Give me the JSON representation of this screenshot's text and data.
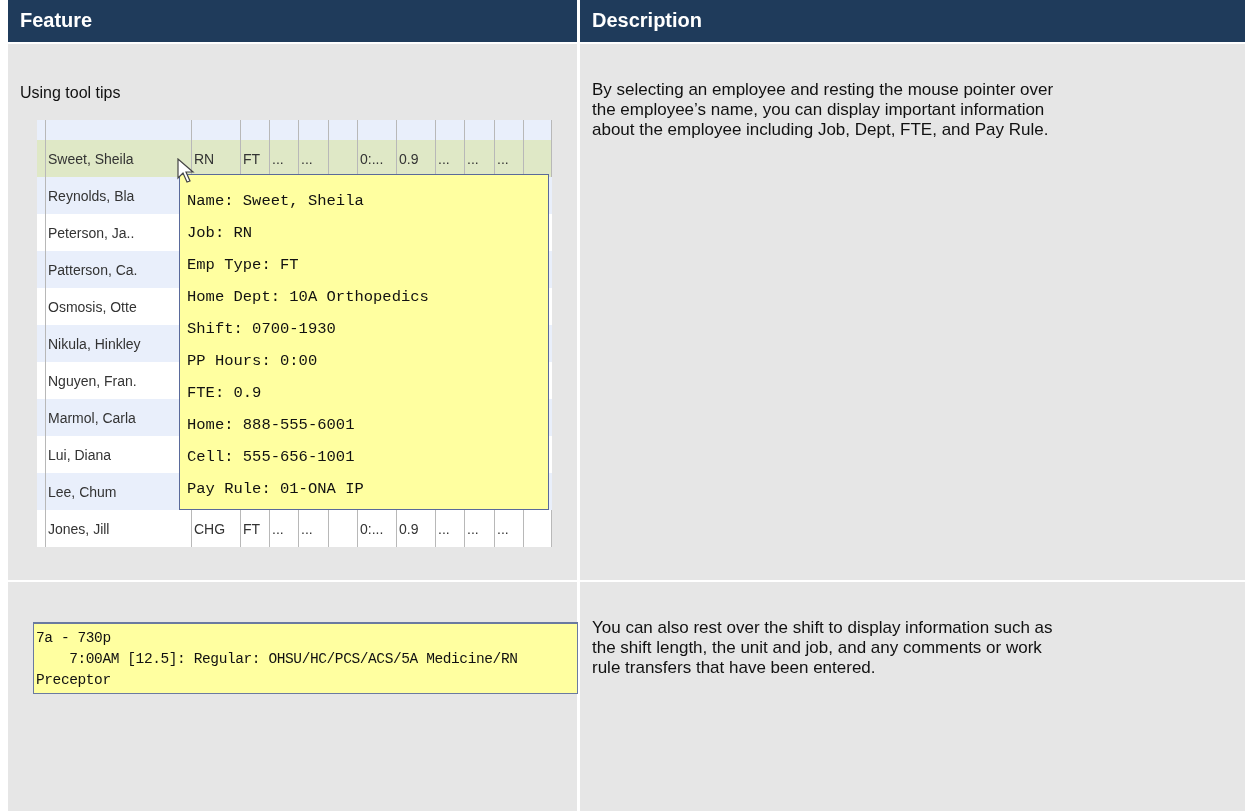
{
  "table": {
    "columns": [
      "Feature",
      "Description"
    ],
    "rows": [
      {
        "feature": "Using tool tips",
        "screenshot": {
          "kind": "roster",
          "rows": [
            {
              "cells": [
                "",
                "",
                "",
                "",
                "",
                "",
                "",
                "",
                "",
                "",
                "",
                ""
              ],
              "selected": false
            },
            {
              "cells": [
                "Sweet, Sheila",
                "RN",
                "FT",
                "...",
                "...",
                "",
                "0:...",
                "0.9",
                "...",
                "...",
                "...",
                ""
              ],
              "selected": true
            },
            {
              "cells": [
                "Reynolds, Bla"
              ],
              "selected": false
            },
            {
              "cells": [
                "Peterson, Ja.."
              ],
              "selected": false
            },
            {
              "cells": [
                "Patterson, Ca."
              ],
              "selected": false
            },
            {
              "cells": [
                "Osmosis, Otte"
              ],
              "selected": false
            },
            {
              "cells": [
                "Nikula, Hinkley"
              ],
              "selected": false
            },
            {
              "cells": [
                "Nguyen, Fran."
              ],
              "selected": false
            },
            {
              "cells": [
                "Marmol, Carla"
              ],
              "selected": false
            },
            {
              "cells": [
                "Lui, Diana"
              ],
              "selected": false
            },
            {
              "cells": [
                "Lee, Chum"
              ],
              "selected": false
            },
            {
              "cells": [
                "Jones, Jill",
                "CHG",
                "FT",
                "...",
                "...",
                "",
                "0:...",
                "0.9",
                "...",
                "...",
                "...",
                ""
              ],
              "selected": false
            }
          ],
          "tooltip": [
            "Name: Sweet, Sheila",
            "Job: RN",
            "Emp Type: FT",
            "Home Dept: 10A Orthopedics",
            "Shift: 0700-1930",
            "PP Hours: 0:00",
            "FTE: 0.9",
            "Home: 888-555-6001",
            "Cell: 555-656-1001",
            "Pay Rule: 01-ONA IP"
          ]
        },
        "description": "By selecting an employee and resting the mouse pointer over the employee’s name, you can display important information about the employee including Job, Dept, FTE, and Pay Rule."
      },
      {
        "screenshot": {
          "kind": "shift",
          "lines": [
            "7a - 730p",
            "    7:00AM [12.5]: Regular: OHSU/HC/PCS/ACS/5A Medicine/RN",
            "Preceptor"
          ]
        },
        "description": "You can also rest over the shift to display information such as the shift length, the unit and job, and any comments or work rule transfers that have been entered."
      }
    ]
  }
}
